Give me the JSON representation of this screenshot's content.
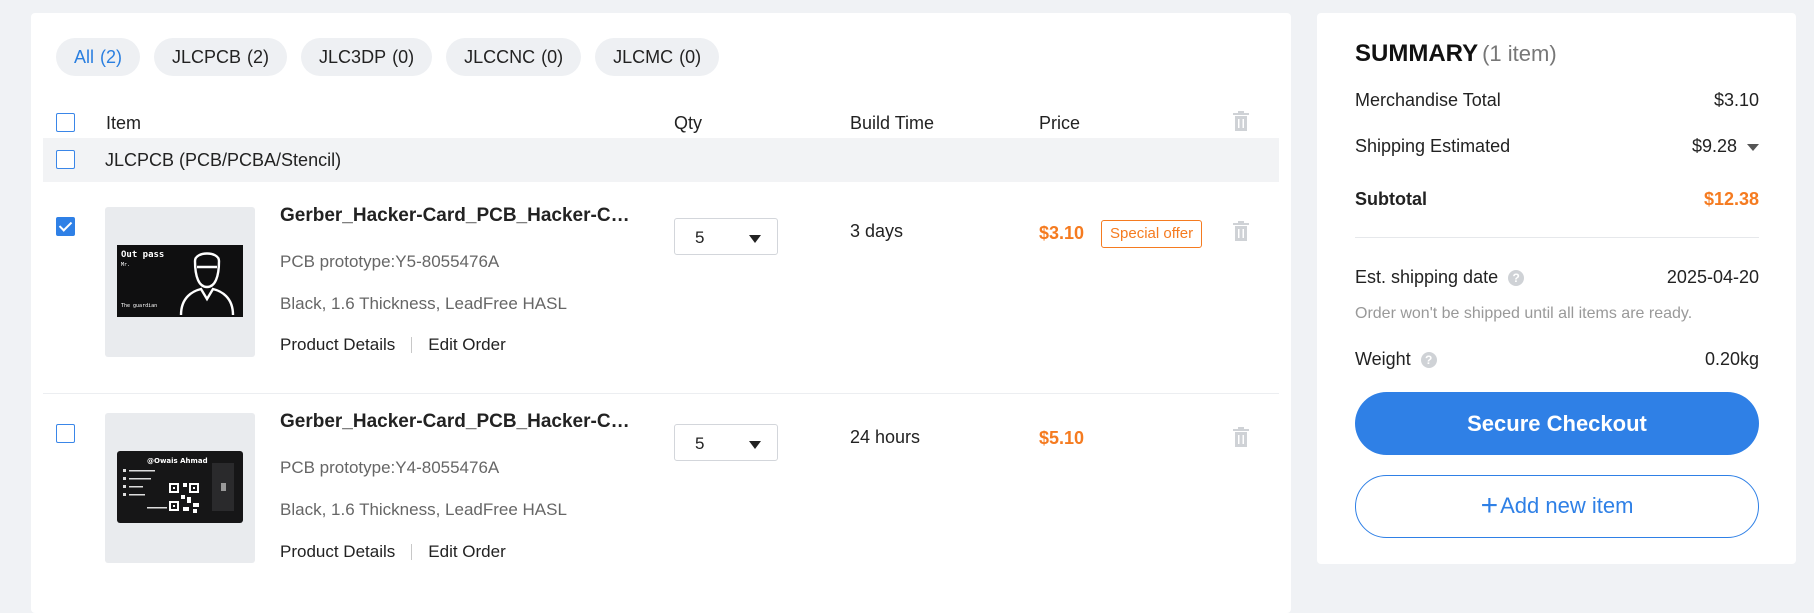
{
  "tabs": [
    {
      "label": "All",
      "count": "(2)"
    },
    {
      "label": "JLCPCB",
      "count": "(2)"
    },
    {
      "label": "JLC3DP",
      "count": "(0)"
    },
    {
      "label": "JLCCNC",
      "count": "(0)"
    },
    {
      "label": "JLCMC",
      "count": "(0)"
    }
  ],
  "table": {
    "headers": {
      "item": "Item",
      "qty": "Qty",
      "build_time": "Build Time",
      "price": "Price"
    },
    "group_label": "JLCPCB (PCB/PCBA/Stencil)",
    "items": [
      {
        "checked": true,
        "title": "Gerber_Hacker-Card_PCB_Hacker-Card_...",
        "prototype": "PCB prototype:Y5-8055476A",
        "spec": "Black, 1.6 Thickness, LeadFree HASL",
        "qty": "5",
        "build_time": "3 days",
        "price": "$3.10",
        "badge": "Special offer",
        "card_text": {
          "line1": "Out pass",
          "line2": "Mr.",
          "line3": "The guardian"
        },
        "links": {
          "details": "Product Details",
          "edit": "Edit Order"
        }
      },
      {
        "checked": false,
        "title": "Gerber_Hacker-Card_PCB_Hacker-Card_...",
        "prototype": "PCB prototype:Y4-8055476A",
        "spec": "Black, 1.6 Thickness, LeadFree HASL",
        "qty": "5",
        "build_time": "24 hours",
        "price": "$5.10",
        "card_text": {
          "name": "@Owais Ahmad"
        },
        "links": {
          "details": "Product Details",
          "edit": "Edit Order"
        }
      }
    ]
  },
  "summary": {
    "title": "SUMMARY",
    "item_count": "(1 item)",
    "merch_label": "Merchandise Total",
    "merch_value": "$3.10",
    "shipping_label": "Shipping Estimated",
    "shipping_value": "$9.28",
    "subtotal_label": "Subtotal",
    "subtotal_value": "$12.38",
    "ship_date_label": "Est. shipping date",
    "ship_date_value": "2025-04-20",
    "ship_note": "Order won't be shipped until all items are ready.",
    "weight_label": "Weight",
    "weight_value": "0.20kg",
    "checkout_label": "Secure Checkout",
    "add_label": "Add new item"
  },
  "colors": {
    "accent": "#2f80e6",
    "price": "#f57b20"
  }
}
